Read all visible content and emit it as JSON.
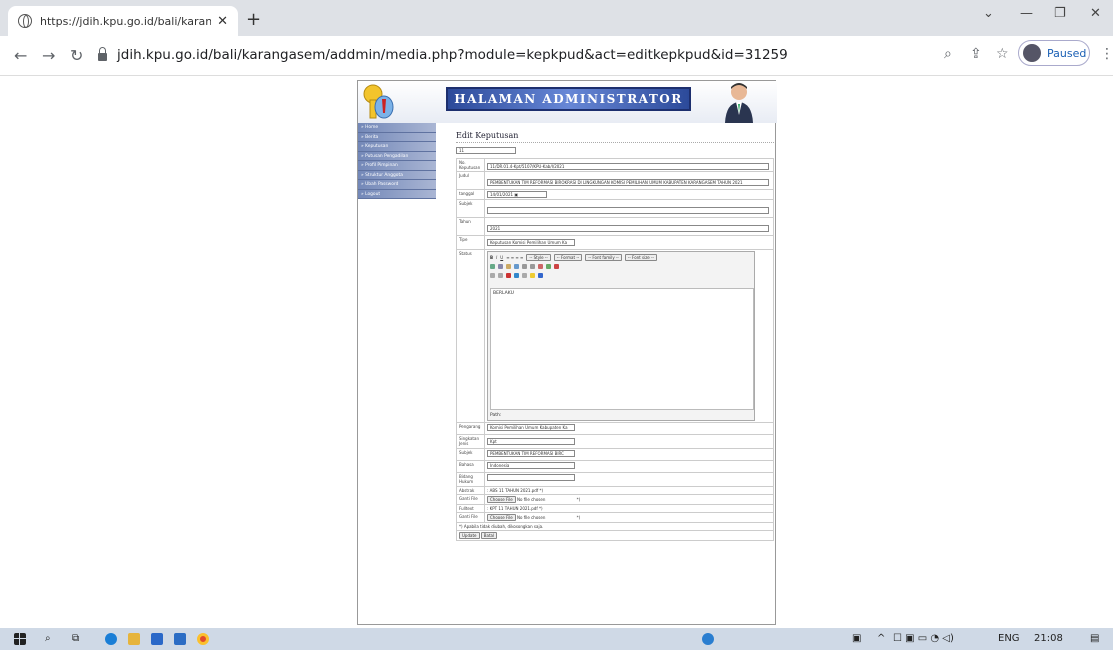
{
  "browser": {
    "tab_title": "https://jdih.kpu.go.id/bali/karang",
    "url": "jdih.kpu.go.id/bali/karangasem/addmin/media.php?module=kepkpud&act=editkepkpud&id=31259",
    "profile_label": "Paused"
  },
  "header": {
    "title": "HALAMAN ADMINISTRATOR"
  },
  "sidebar": {
    "items": [
      {
        "label": "» Home"
      },
      {
        "label": "» Berita"
      },
      {
        "label": "» Keputusan"
      },
      {
        "label": "» Putusan Pengadilan"
      },
      {
        "label": "» Profil Pimpinan"
      },
      {
        "label": "» Struktur Anggota"
      },
      {
        "label": "» Ubah Password"
      },
      {
        "label": "» Logout"
      }
    ]
  },
  "form": {
    "heading": "Edit Keputusan",
    "id_value": "11",
    "labels": {
      "no": "No. Keputusan",
      "judul": "Judul",
      "tanggal": "tanggal",
      "subjek": "Subjek",
      "tahun": "Tahun",
      "tipe": "Tipe",
      "status": "Status",
      "pengarang": "Pengarang",
      "singkatan": "Singkatan Jenis",
      "subjek2": "Subjek",
      "bahasa": "Bahasa",
      "bidang": "Bidang Hukum",
      "abstrak": "Abstrak",
      "ganti1": "Ganti File",
      "fulltext": "Fulltext",
      "ganti2": "Ganti File"
    },
    "values": {
      "no": "11/DR.01.4-Kpt/5107/KPU-Kab/I/2021",
      "judul": "PEMBENTUKAN TIM REFORMASI BIROKRASI DI LINGKUNGAN KOMISI PEMILIHAN UMUM KABUPATEN KARANGASEM TAHUN 2021",
      "tanggal": "14/01/2021",
      "subjek": "",
      "tahun": "2021",
      "tipe": "Keputusan Komisi Pemilihan Umum Ka",
      "status_text": "BERLAKU",
      "pengarang": "Komisi Pemilihan Umum Kabupaten Ka",
      "singkatan": "Kpt",
      "subjek2": "PEMBENTUKAN TIM REFORMASI BIRC",
      "bahasa": "Indonesia",
      "bidang": "",
      "abstrak": ": ABS 11 TAHUN 2021.pdf *)",
      "fulltext": ": KPT 11 TAHUN 2021.pdf *)",
      "choose_file": "Choose File",
      "no_file": "No file chosen",
      "asterisk": "*)",
      "note": "*) Apabila tidak diubah, dikosongkan saja.",
      "update": "Update",
      "batal": "Batal",
      "path": "Path:"
    },
    "editor_toolbar": {
      "style": "-- Style --",
      "format": "-- Format --",
      "font": "-- Font family --",
      "size": "-- Font size --"
    }
  },
  "taskbar": {
    "lang": "ENG",
    "time": "21:08"
  }
}
